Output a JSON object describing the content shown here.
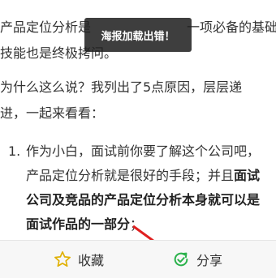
{
  "article": {
    "p1_line1_start": "产品定位分析是",
    "p1_line1_end": "一项必备的基础",
    "p1_line2": "技能也是终极拷问。",
    "p2_line1": "为什么这么说？我列出了5点原因，层层递",
    "p2_line2": "进，一起来看看：",
    "list_number": "1.",
    "li_line1": "作为小白，面试前你要了解这个公司吧，",
    "li_line2_normal": "产品定位分析就是很好的手段；并且",
    "li_line2_bold": "面试",
    "li_line3_bold": "公司及竞品的产品定位分析本身就可以是",
    "li_line4_bold": "面试作品的一部分",
    "li_line4_normal": "；"
  },
  "toast": {
    "message": "海报加载出错！"
  },
  "bottom_bar": {
    "favorite_label": "收藏",
    "share_label": "分享",
    "favorite_icon": "star-icon",
    "share_icon": "share-icon",
    "share_icon_color": "#2bb24c",
    "favorite_icon_color": "#e0b000"
  },
  "annotation": {
    "arrow_color": "#e02020"
  }
}
